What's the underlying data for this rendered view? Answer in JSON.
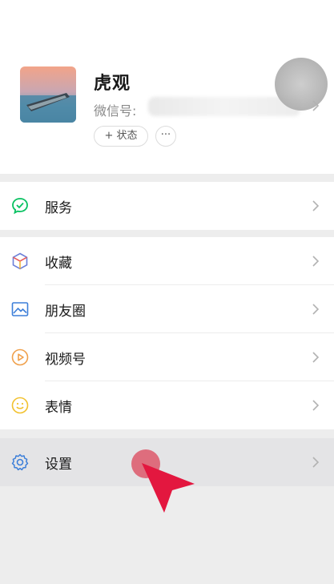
{
  "profile": {
    "nickname": "虎观",
    "wechat_id_label": "微信号:",
    "status_button": "+ 状态",
    "more_button": "···"
  },
  "menu_service": [
    {
      "label": "服务",
      "icon": "service-icon"
    }
  ],
  "menu_main": [
    {
      "label": "收藏",
      "icon": "favorites-icon"
    },
    {
      "label": "朋友圈",
      "icon": "moments-icon"
    },
    {
      "label": "视频号",
      "icon": "channels-icon"
    },
    {
      "label": "表情",
      "icon": "stickers-icon"
    }
  ],
  "menu_settings": [
    {
      "label": "设置",
      "icon": "settings-icon"
    }
  ],
  "colors": {
    "background": "#ededed",
    "service_green": "#07c160",
    "settings_blue": "#3d7fd9",
    "cursor_red": "#e3173f"
  }
}
